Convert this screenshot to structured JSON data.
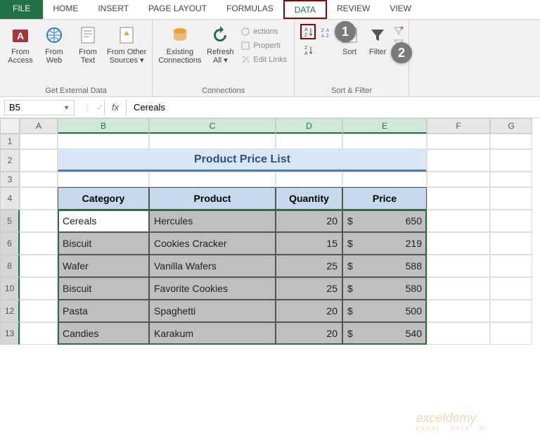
{
  "tabs": {
    "file": "FILE",
    "home": "HOME",
    "insert": "INSERT",
    "page": "PAGE LAYOUT",
    "formulas": "FORMULAS",
    "data": "DATA",
    "review": "REVIEW",
    "view": "VIEW"
  },
  "ribbon": {
    "getdata": {
      "label": "Get External Data",
      "access": "From\nAccess",
      "web": "From\nWeb",
      "text": "From\nText",
      "other": "From Other\nSources ▾"
    },
    "conn": {
      "label": "Connections",
      "existing": "Existing\nConnections",
      "refresh": "Refresh\nAll ▾",
      "c1": "ections",
      "c2": "Properti",
      "c3": "Edit Links"
    },
    "sort": {
      "label": "Sort & Filter",
      "sort": "Sort",
      "filter": "Filter"
    }
  },
  "annotations": {
    "n1": "1",
    "n2": "2"
  },
  "fbar": {
    "name": "B5",
    "fx": "fx",
    "val": "Cereals"
  },
  "cols": [
    "A",
    "B",
    "C",
    "D",
    "E",
    "F",
    "G"
  ],
  "rows": [
    "1",
    "2",
    "3",
    "4",
    "5",
    "6",
    "8",
    "10",
    "12",
    "13"
  ],
  "sheet": {
    "title": "Product Price List",
    "headers": {
      "cat": "Category",
      "prod": "Product",
      "qty": "Quantity",
      "price": "Price"
    },
    "data": [
      {
        "cat": "Cereals",
        "prod": "Hercules",
        "qty": "20",
        "price": "650"
      },
      {
        "cat": "Biscuit",
        "prod": "Cookies Cracker",
        "qty": "15",
        "price": "219"
      },
      {
        "cat": "Wafer",
        "prod": "Vanilla Wafers",
        "qty": "25",
        "price": "588"
      },
      {
        "cat": "Biscuit",
        "prod": "Favorite Cookies",
        "qty": "25",
        "price": "580"
      },
      {
        "cat": "Pasta",
        "prod": "Spaghetti",
        "qty": "20",
        "price": "500"
      },
      {
        "cat": "Candies",
        "prod": "Karakum",
        "qty": "20",
        "price": "540"
      }
    ],
    "currency": "$"
  },
  "wm": {
    "t": "exceldemy",
    "s": "EXCEL · DATA · BI"
  },
  "chart_data": {
    "type": "table",
    "title": "Product Price List",
    "columns": [
      "Category",
      "Product",
      "Quantity",
      "Price"
    ],
    "rows": [
      [
        "Cereals",
        "Hercules",
        20,
        650
      ],
      [
        "Biscuit",
        "Cookies Cracker",
        15,
        219
      ],
      [
        "Wafer",
        "Vanilla Wafers",
        25,
        588
      ],
      [
        "Biscuit",
        "Favorite Cookies",
        25,
        580
      ],
      [
        "Pasta",
        "Spaghetti",
        20,
        500
      ],
      [
        "Candies",
        "Karakum",
        20,
        540
      ]
    ]
  }
}
